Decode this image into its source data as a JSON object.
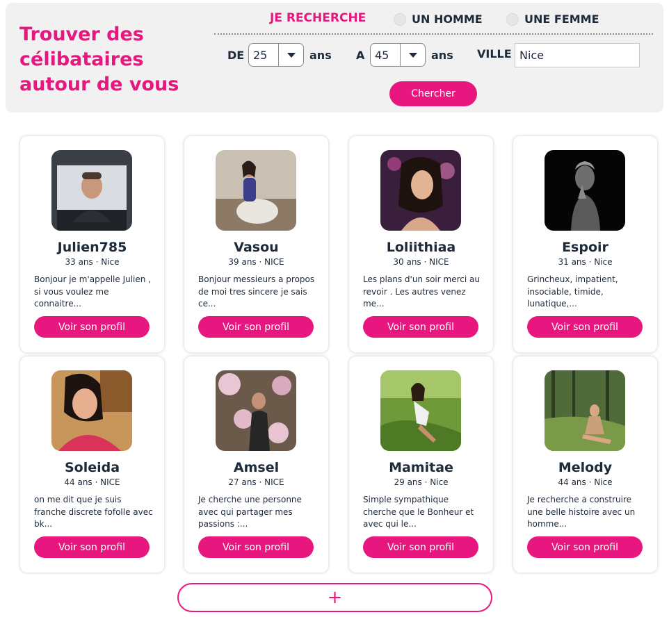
{
  "search": {
    "headline": [
      "Trouver des",
      "célibataires",
      "autour de vous"
    ],
    "seek_label": "JE RECHERCHE",
    "option_homme": "UN HOMME",
    "option_femme": "UNE FEMME",
    "from_label": "DE",
    "from_value": "25",
    "to_label": "A",
    "to_value": "45",
    "ans_label": "ans",
    "city_label": "VILLE",
    "city_value": "Nice",
    "submit_label": "Chercher"
  },
  "profiles": [
    {
      "name": "Julien785",
      "meta": "33 ans · Nice",
      "bio": "Bonjour je m'appelle Julien , si vous voulez me connaitre...",
      "button": "Voir son profil"
    },
    {
      "name": "Vasou",
      "meta": "39 ans · NICE",
      "bio": "Bonjour messieurs a propos de moi tres sincere je sais ce...",
      "button": "Voir son profil"
    },
    {
      "name": "Loliithiaa",
      "meta": "30 ans · NICE",
      "bio": "Les plans d'un soir merci au revoir . Les autres venez me...",
      "button": "Voir son profil"
    },
    {
      "name": "Espoir",
      "meta": "31 ans · Nice",
      "bio": "Grincheux, impatient, insociable, timide, lunatique,...",
      "button": "Voir son profil"
    },
    {
      "name": "Soleida",
      "meta": "44 ans · NICE",
      "bio": "on me dit que je suis franche discrete fofolle avec bk...",
      "button": "Voir son profil"
    },
    {
      "name": "Amsel",
      "meta": "27 ans · NICE",
      "bio": "Je cherche une personne avec qui partager mes passions :...",
      "button": "Voir son profil"
    },
    {
      "name": "Mamitae",
      "meta": "29 ans · Nice",
      "bio": "Simple sympathique cherche que le Bonheur et avec qui le...",
      "button": "Voir son profil"
    },
    {
      "name": "Melody",
      "meta": "44 ans · Nice",
      "bio": "Je recherche a construire une belle histoire avec un homme...",
      "button": "Voir son profil"
    }
  ],
  "load_more_label": "+",
  "colors": {
    "accent": "#e8177f",
    "text": "#1d2a3a",
    "panel": "#f1f1f1"
  }
}
